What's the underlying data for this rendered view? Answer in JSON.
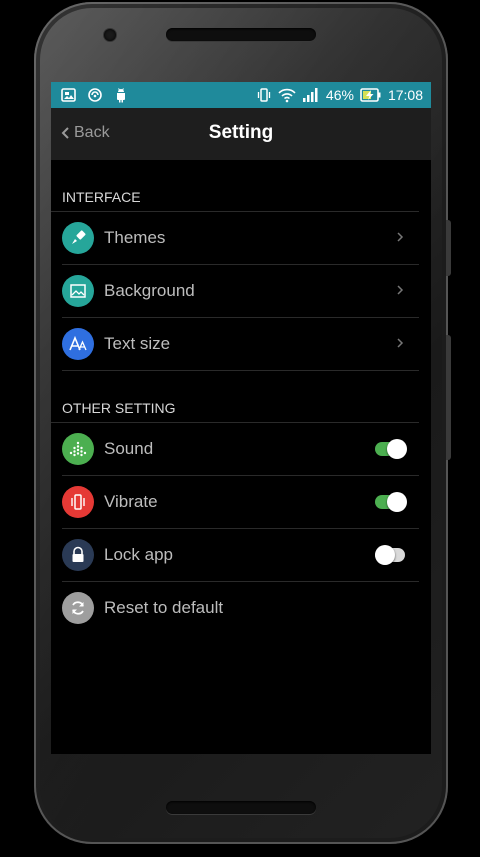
{
  "status_bar": {
    "battery_percent": "46%",
    "time": "17:08",
    "color": "#1f8a9b",
    "icons_left": [
      "gallery-icon",
      "sync-icon",
      "android-icon"
    ],
    "icons_right": [
      "vibrate-icon",
      "wifi-icon",
      "signal-icon",
      "battery-charging-icon"
    ]
  },
  "app_bar": {
    "back_label": "Back",
    "title": "Setting"
  },
  "sections": {
    "interface": {
      "header": "INTERFACE",
      "items": [
        {
          "label": "Themes",
          "icon": "paint-brush-icon",
          "icon_color": "#26a69a",
          "control": "chevron"
        },
        {
          "label": "Background",
          "icon": "image-icon",
          "icon_color": "#26a69a",
          "control": "chevron"
        },
        {
          "label": "Text size",
          "icon": "text-size-icon",
          "icon_color": "#2f6fe0",
          "control": "chevron"
        }
      ]
    },
    "other": {
      "header": "OTHER SETTING",
      "items": [
        {
          "label": "Sound",
          "icon": "sound-icon",
          "icon_color": "#4caf50",
          "control": "toggle",
          "on": true
        },
        {
          "label": "Vibrate",
          "icon": "vibrate-icon",
          "icon_color": "#e53935",
          "control": "toggle",
          "on": true
        },
        {
          "label": "Lock app",
          "icon": "lock-icon",
          "icon_color": "#2a3a55",
          "control": "toggle",
          "on": false
        },
        {
          "label": "Reset to default",
          "icon": "reset-icon",
          "icon_color": "#9e9e9e",
          "control": "none"
        }
      ]
    }
  },
  "colors": {
    "toggle_on": "#4caf50",
    "toggle_off": "#d9d9d9"
  }
}
